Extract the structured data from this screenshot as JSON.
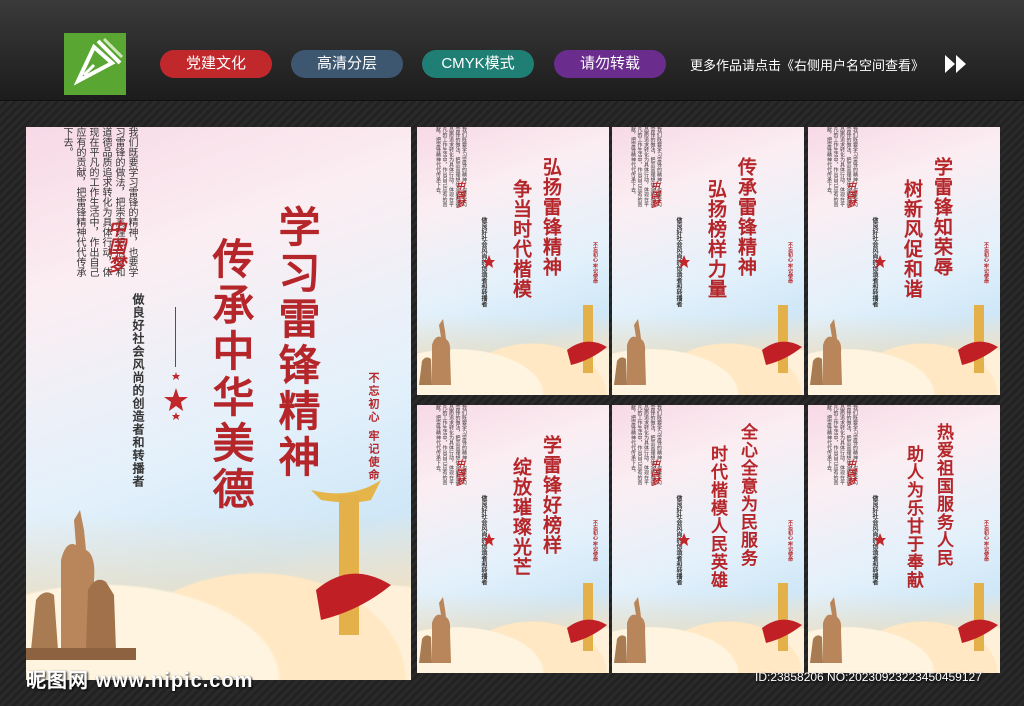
{
  "header": {
    "tags": [
      "党建文化",
      "高清分层",
      "CMYK模式",
      "请勿转载"
    ],
    "more_text": "更多作品请点击《右侧用户名空间查看》",
    "logo_icon": "pen-nib-icon",
    "arrow_icon": "double-chevron-right-icon",
    "colors": {
      "tag1": "#c0282c",
      "tag2": "#3d5770",
      "tag3": "#1f7f75",
      "tag4": "#6a2d8e",
      "logo": "#5aa632",
      "title_red": "#b5262a"
    }
  },
  "main_poster": {
    "title_line1": "学习雷锋精神",
    "title_line2": "传承中华美德",
    "subtitle": "做良好社会风尚的创造者和转播者",
    "body": "我们既要学习雷锋的精神，也要学习雷锋的做法，把崇高理想信念和道德品质追求转化为具体行动，体现在平凡的工作生活中，作出自己应有的贡献，把雷锋精神代代传承下去。",
    "seal": "不忘初心 牢记使命",
    "brand": "中国梦"
  },
  "small_posters": [
    {
      "line1": "弘扬雷锋精神",
      "line2": "争当时代楷模"
    },
    {
      "line1": "传承雷锋精神",
      "line2": "弘扬榜样力量"
    },
    {
      "line1": "学雷锋知荣辱",
      "line2": "树新风促和谐"
    },
    {
      "line1": "学雷锋好榜样",
      "line2": "绽放璀璨光芒"
    },
    {
      "line1": "全心全意为民服务",
      "line2": "时代楷模人民英雄"
    },
    {
      "line1": "热爱祖国服务人民",
      "line2": "助人为乐甘于奉献"
    }
  ],
  "small_common": {
    "subtitle": "做良好社会风尚的创造者和转播者",
    "body": "我们既要学习雷锋的精神，也要学习雷锋的做法，把崇高理想信念和道德品质追求转化为具体行动，体现在平凡的工作生活中，作出自己应有的贡献，把雷锋精神代代传承下去。",
    "seal": "不忘初心 牢记使命",
    "brand": "中国梦"
  },
  "watermark": {
    "site": "昵图网 www.nipic.com",
    "id": "ID:23858206 NO:20230923223450459127"
  }
}
